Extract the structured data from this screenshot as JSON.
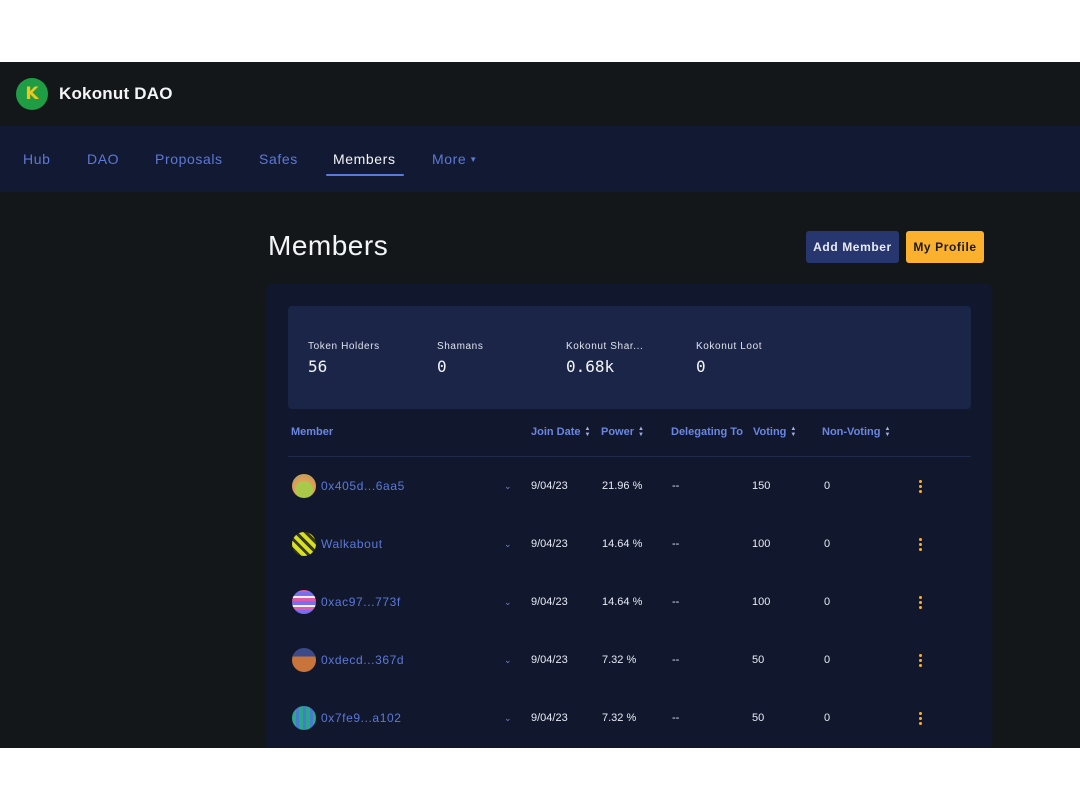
{
  "app": {
    "title": "Kokonut DAO",
    "logo_letter": "K"
  },
  "nav": {
    "items": [
      {
        "label": "Hub"
      },
      {
        "label": "DAO"
      },
      {
        "label": "Proposals"
      },
      {
        "label": "Safes"
      },
      {
        "label": "Members"
      },
      {
        "label": "More"
      }
    ],
    "active": "Members"
  },
  "page": {
    "title": "Members",
    "add_member_label": "Add Member",
    "my_profile_label": "My Profile"
  },
  "stats": [
    {
      "label": "Token Holders",
      "value": "56"
    },
    {
      "label": "Shamans",
      "value": "0"
    },
    {
      "label": "Kokonut Shar...",
      "value": "0.68k"
    },
    {
      "label": "Kokonut Loot",
      "value": "0"
    }
  ],
  "table": {
    "headers": {
      "member": "Member",
      "join_date": "Join Date",
      "power": "Power",
      "delegating_to": "Delegating To",
      "voting": "Voting",
      "non_voting": "Non-Voting"
    },
    "rows": [
      {
        "member": "0x405d...6aa5",
        "join_date": "9/04/23",
        "power": "21.96 %",
        "delegating_to": "--",
        "voting": "150",
        "non_voting": "0"
      },
      {
        "member": "Walkabout",
        "join_date": "9/04/23",
        "power": "14.64 %",
        "delegating_to": "--",
        "voting": "100",
        "non_voting": "0"
      },
      {
        "member": "0xac97...773f",
        "join_date": "9/04/23",
        "power": "14.64 %",
        "delegating_to": "--",
        "voting": "100",
        "non_voting": "0"
      },
      {
        "member": "0xdecd...367d",
        "join_date": "9/04/23",
        "power": "7.32 %",
        "delegating_to": "--",
        "voting": "50",
        "non_voting": "0"
      },
      {
        "member": "0x7fe9...a102",
        "join_date": "9/04/23",
        "power": "7.32 %",
        "delegating_to": "--",
        "voting": "50",
        "non_voting": "0"
      }
    ]
  },
  "colors": {
    "accent": "#5c78d8",
    "primary_button": "#27366e",
    "secondary_button": "#fcb12e",
    "background": "#141719",
    "nav_background": "#121a33"
  },
  "icons": {
    "logo": "kokonut-logo-icon",
    "more": "chevron-down-icon",
    "sort": "sort-arrows-icon",
    "expand": "chevron-down-icon",
    "row_menu": "kebab-menu-icon"
  }
}
